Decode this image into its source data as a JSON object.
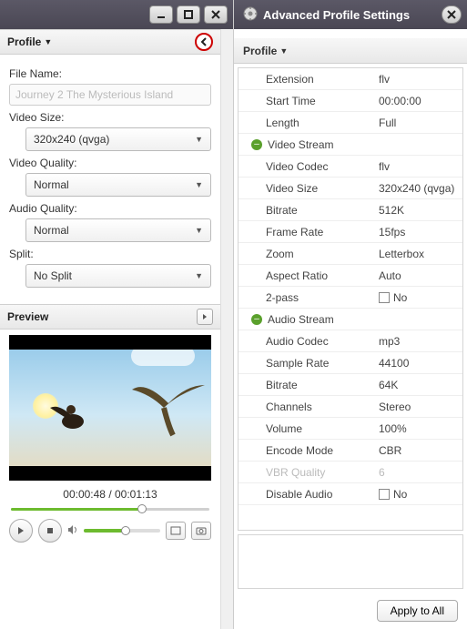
{
  "left": {
    "profile_header": "Profile",
    "file_name_label": "File Name:",
    "file_name_value": "Journey 2 The Mysterious Island",
    "video_size_label": "Video Size:",
    "video_size_value": "320x240 (qvga)",
    "video_quality_label": "Video Quality:",
    "video_quality_value": "Normal",
    "audio_quality_label": "Audio Quality:",
    "audio_quality_value": "Normal",
    "split_label": "Split:",
    "split_value": "No Split",
    "preview_header": "Preview",
    "time_current": "00:00:48",
    "time_total": "00:01:13",
    "seek_pct": 66,
    "volume_pct": 55
  },
  "right": {
    "window_title": "Advanced Profile Settings",
    "profile_header": "Profile",
    "apply_label": "Apply to All",
    "rows": [
      {
        "key": "Extension",
        "val": "flv"
      },
      {
        "key": "Start Time",
        "val": "00:00:00"
      },
      {
        "key": "Length",
        "val": "Full"
      },
      {
        "group": "Video Stream"
      },
      {
        "key": "Video Codec",
        "val": "flv"
      },
      {
        "key": "Video Size",
        "val": "320x240 (qvga)"
      },
      {
        "key": "Bitrate",
        "val": "512K"
      },
      {
        "key": "Frame Rate",
        "val": "15fps"
      },
      {
        "key": "Zoom",
        "val": "Letterbox"
      },
      {
        "key": "Aspect Ratio",
        "val": "Auto"
      },
      {
        "key": "2-pass",
        "val": "No",
        "checkbox": true
      },
      {
        "group": "Audio Stream"
      },
      {
        "key": "Audio Codec",
        "val": "mp3"
      },
      {
        "key": "Sample Rate",
        "val": "44100"
      },
      {
        "key": "Bitrate",
        "val": "64K"
      },
      {
        "key": "Channels",
        "val": "Stereo"
      },
      {
        "key": "Volume",
        "val": "100%"
      },
      {
        "key": "Encode Mode",
        "val": "CBR"
      },
      {
        "key": "VBR Quality",
        "val": "6",
        "disabled": true
      },
      {
        "key": "Disable Audio",
        "val": "No",
        "checkbox": true
      }
    ]
  }
}
